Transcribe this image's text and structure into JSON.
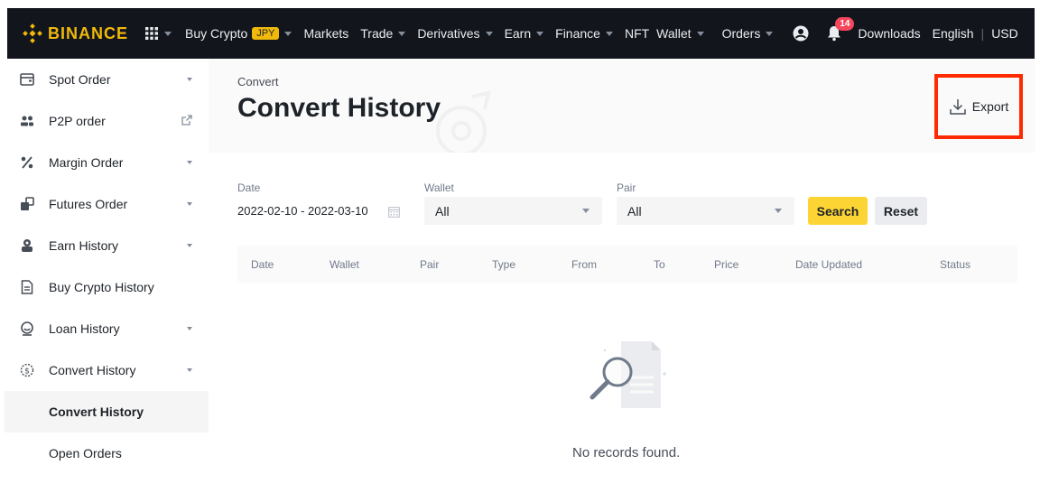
{
  "nav": {
    "logo_text": "BINANCE",
    "items": [
      {
        "label": "Buy Crypto",
        "badge": "JPY",
        "caret": true
      },
      {
        "label": "Markets",
        "caret": false
      },
      {
        "label": "Trade",
        "caret": true
      },
      {
        "label": "Derivatives",
        "caret": true
      },
      {
        "label": "Earn",
        "caret": true
      },
      {
        "label": "Finance",
        "caret": true
      },
      {
        "label": "NFT",
        "caret": false
      },
      {
        "label": "Wallet",
        "caret": true
      },
      {
        "label": "Orders",
        "caret": true
      }
    ],
    "notification_count": "14",
    "downloads": "Downloads",
    "language": "English",
    "currency": "USD",
    "brand_color": "#f0b90b",
    "bar_color": "#12161c"
  },
  "sidebar": {
    "items": [
      {
        "label": "Spot Order",
        "icon": "wallet-icon",
        "right": "caret"
      },
      {
        "label": "P2P order",
        "icon": "users-icon",
        "right": "external-link-icon"
      },
      {
        "label": "Margin Order",
        "icon": "percent-icon",
        "right": "caret"
      },
      {
        "label": "Futures Order",
        "icon": "futures-icon",
        "right": "caret"
      },
      {
        "label": "Earn History",
        "icon": "piggy-icon",
        "right": "caret"
      },
      {
        "label": "Buy Crypto History",
        "icon": "document-icon",
        "right": ""
      },
      {
        "label": "Loan History",
        "icon": "loan-icon",
        "right": "caret"
      },
      {
        "label": "Convert History",
        "icon": "coin-icon",
        "right": "caret"
      },
      {
        "label": "Convert History",
        "icon": "",
        "right": "",
        "active": true
      },
      {
        "label": "Open Orders",
        "icon": "",
        "right": ""
      }
    ]
  },
  "header": {
    "breadcrumb": "Convert",
    "title": "Convert History",
    "export_label": "Export",
    "highlight_color": "#ff2a00"
  },
  "filters": {
    "date_label": "Date",
    "date_value": "2022-02-10 - 2022-03-10",
    "wallet_label": "Wallet",
    "wallet_value": "All",
    "pair_label": "Pair",
    "pair_value": "All",
    "search_label": "Search",
    "reset_label": "Reset"
  },
  "table": {
    "columns": [
      "Date",
      "Wallet",
      "Pair",
      "Type",
      "From",
      "To",
      "Price",
      "Date Updated",
      "Status"
    ]
  },
  "empty": {
    "message": "No records found."
  }
}
